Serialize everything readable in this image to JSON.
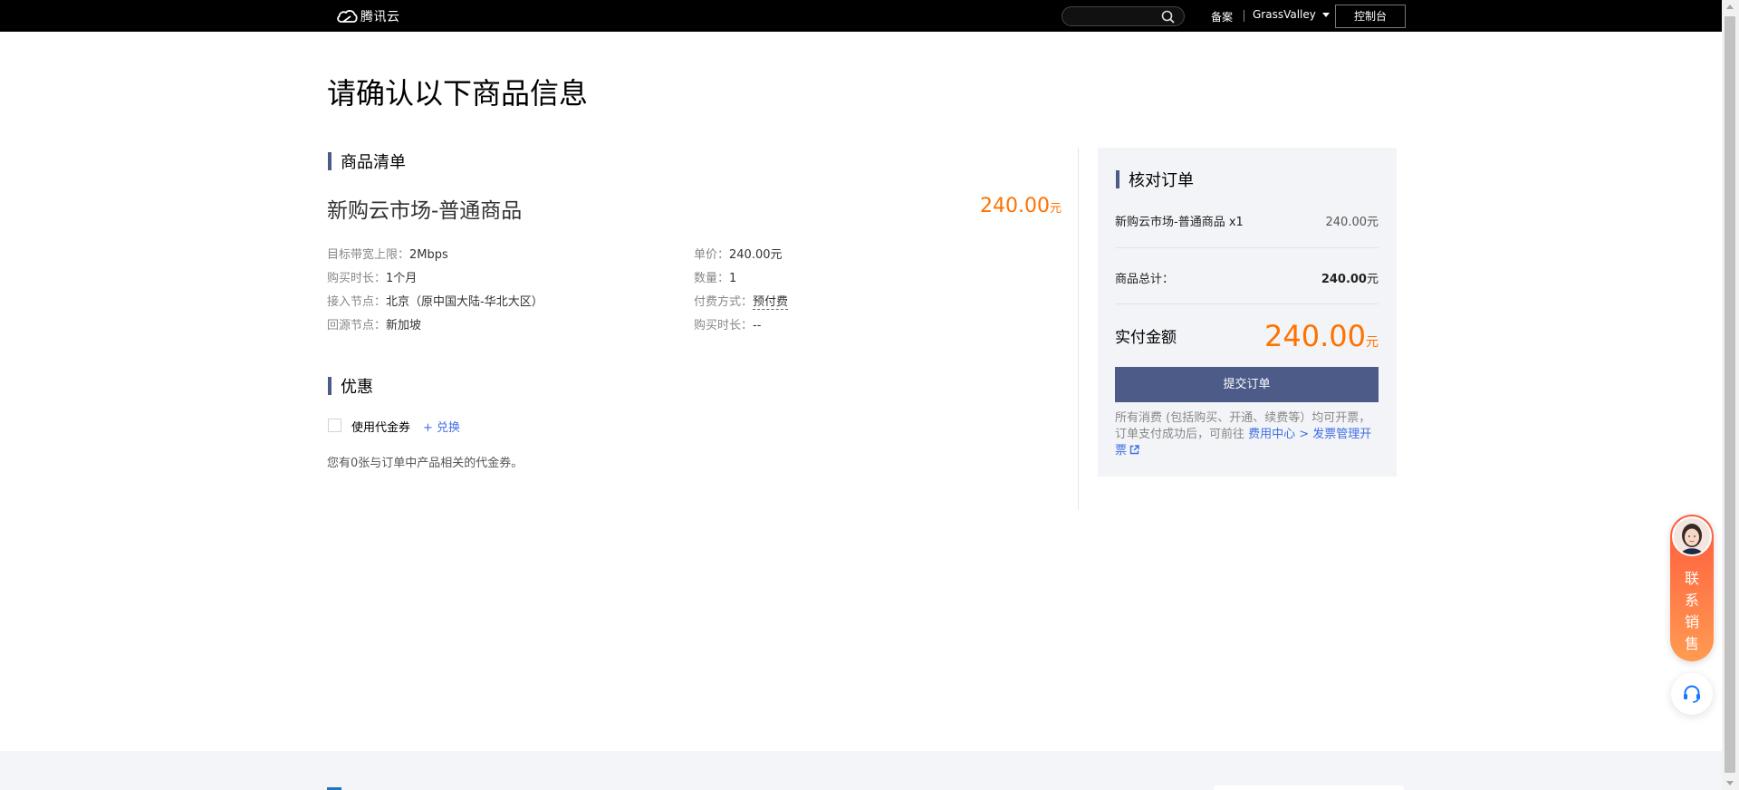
{
  "topbar": {
    "logo_text": "腾讯云",
    "search_placeholder": "",
    "beian": "备案",
    "user": "GrassValley",
    "console": "控制台"
  },
  "page_title": "请确认以下商品信息",
  "goods": {
    "section_title": "商品清单",
    "name": "新购云市场-普通商品",
    "price": "240.00",
    "price_unit": "元",
    "specs_left": [
      {
        "key": "目标带宽上限：",
        "value": "2Mbps"
      },
      {
        "key": "购买时长：",
        "value": "1个月"
      },
      {
        "key": "接入节点：",
        "value": "北京（原中国大陆-华北大区）"
      },
      {
        "key": "回源节点：",
        "value": "新加坡"
      }
    ],
    "specs_right": [
      {
        "key": "单价：",
        "value": "240.00元"
      },
      {
        "key": "数量：",
        "value": "1"
      },
      {
        "key": "付费方式：",
        "value": "预付费"
      },
      {
        "key": "购买时长：",
        "value": "--"
      }
    ]
  },
  "discount": {
    "section_title": "优惠",
    "use_voucher": "使用代金券",
    "redeem": "+ 兑换",
    "note": "您有0张与订单中产品相关的代金券。"
  },
  "order": {
    "title": "核对订单",
    "item_label": "新购云市场-普通商品 x1",
    "item_price": "240.00元",
    "total_label": "商品总计：",
    "total_value": "240.00",
    "total_unit": "元",
    "pay_label": "实付金额",
    "pay_amount": "240.00",
    "pay_unit": "元",
    "submit": "提交订单",
    "invoice_text": "所有消费 (包括购买、开通、续费等）均可开票，订单支付成功后，可前往 ",
    "invoice_link": "费用中心 > 发票管理开票"
  },
  "float": {
    "sales_chars": [
      "联",
      "系",
      "销",
      "售"
    ]
  },
  "colors": {
    "accent": "#4d5b89",
    "price": "#ff7200",
    "link": "#3f6fe3"
  }
}
